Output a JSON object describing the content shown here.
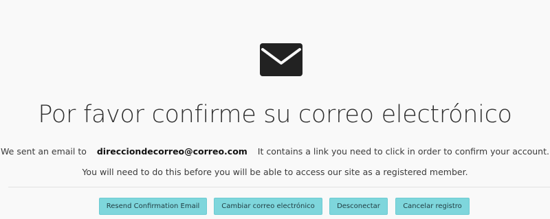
{
  "icon": "envelope-icon",
  "title": "Por favor confirme su correo electrónico",
  "message": {
    "prefix": "We sent an email to",
    "email": "direcciondecorreo@correo.com",
    "suffix": "It contains a link you need to click in order to confirm your account.",
    "line2": "You will need to do this before you will be able to access our site as a registered member."
  },
  "buttons": {
    "resend": "Resend Confirmation Email",
    "change_email": "Cambiar correo electrónico",
    "logout": "Desconectar",
    "cancel": "Cancelar registro"
  },
  "colors": {
    "button_bg": "#7ed6dc",
    "icon": "#222222"
  }
}
